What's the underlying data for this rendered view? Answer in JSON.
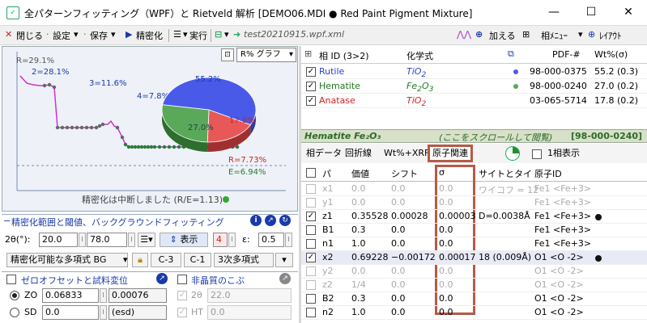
{
  "window": {
    "title": "全パターンフィッティング（WPF）と Rietveld 解析 [DEMO06.MDI ● Red Paint Pigment Mixture]",
    "minimize": "—",
    "maximize": "☐",
    "close": "✕"
  },
  "toolbar": {
    "close": "閉じる",
    "settings": "設定",
    "save": "保存",
    "refine": "精密化",
    "run": "実行",
    "filename": "test20210915.wpf.xml",
    "add": "加える",
    "phase_menu": "相ﾒﾆｭｰ",
    "layout": "ﾚｲｱｳﾄ"
  },
  "chart": {
    "r_label": "R=29.1%",
    "p2": "2=28.1%",
    "p3": "3=11.6%",
    "p4": "4=7.8%",
    "r_final": "R=7.73%",
    "e_final": "E=6.94%",
    "status": "精密化は中断しました (R/E=1.13)",
    "mode": "R% グラフ",
    "pie": [
      {
        "label": "55.2%",
        "value": 55.2,
        "color": "#4a5ae8"
      },
      {
        "label": "17.8%",
        "value": 17.8,
        "color": "#e85858"
      },
      {
        "label": "27.0%",
        "value": 27.0,
        "color": "#5aa85a"
      }
    ]
  },
  "settings": {
    "section1": "精密化範囲と閾値、バックグラウンドフィッティング",
    "two_theta_label": "2θ(°):",
    "two_theta_min": "20.0",
    "two_theta_max": "78.0",
    "show": "表示",
    "num4": "4",
    "eps_label": "ε:",
    "eps": "0.5",
    "bg_model": "精密化可能な多項式 BG",
    "c3": "C-3",
    "c1": "C-1",
    "poly": "3次多項式",
    "section2": "ゼロオフセットと試料変位",
    "section3": "非晶質のこぶ",
    "zo_label": "ZO",
    "zo_value": "0.06833",
    "zo_err": "0.00076",
    "sd_label": "SD",
    "sd_value": "0.0",
    "sd_err": "(esd)",
    "theta2_label": "2θ",
    "theta2_value": "22.0",
    "ht_label": "HT",
    "ht_value": "0.0"
  },
  "phases": {
    "col_id": "相 ID (3>2)",
    "col_formula": "化学式",
    "col_pdf": "PDF-#",
    "col_wt": "Wt%(σ)",
    "rows": [
      {
        "name": "Rutile",
        "formula": "TiO",
        "sub": "2",
        "pdf": "98-000-0375",
        "wt": "55.2 (0.3)",
        "color": "#2244cc",
        "dot": "#4a5ae8"
      },
      {
        "name": "Hematite",
        "formula": "Fe",
        "sub": "2",
        "formula2": "O",
        "sub2": "3",
        "pdf": "98-000-0240",
        "wt": "27.0 (0.2)",
        "color": "#227722",
        "dot": "#5aa85a"
      },
      {
        "name": "Anatase",
        "formula": "TiO",
        "sub": "2",
        "pdf": "03-065-5714",
        "wt": "17.8 (0.2)",
        "color": "#cc2222",
        "dot": ""
      }
    ]
  },
  "detail": {
    "phase_name": "Hematite Fe₂O₃",
    "hint": "(ここをスクロールして閲覧)",
    "pdf": "[98-000-0240]",
    "tabs": [
      "相データ",
      "回折線",
      "Wt%+XRF",
      "原子関連"
    ],
    "single": "1相表示",
    "headers": [
      "パ",
      "価値",
      "シフト",
      "σ",
      "サイトとタイ",
      "原子ID"
    ],
    "rows": [
      {
        "p": "x1",
        "v": "0.0",
        "s": "0.0",
        "sig": "0.0",
        "site": "ワイコフ = 12",
        "atom": "Fe1 <Fe+3>",
        "checked": false,
        "gray": true,
        "dot": false
      },
      {
        "p": "y1",
        "v": "0.0",
        "s": "0.0",
        "sig": "0.0",
        "site": "",
        "atom": "Fe1 <Fe+3>",
        "checked": false,
        "gray": true,
        "dot": false
      },
      {
        "p": "z1",
        "v": "0.35528",
        "s": "0.00028",
        "sig": "0.00003",
        "site": "D=0.0038Å",
        "atom": "Fe1 <Fe+3>",
        "checked": true,
        "gray": false,
        "dot": true
      },
      {
        "p": "B1",
        "v": "0.3",
        "s": "0.0",
        "sig": "0.0",
        "site": "",
        "atom": "Fe1 <Fe+3>",
        "checked": false,
        "gray": false,
        "dot": false
      },
      {
        "p": "n1",
        "v": "1.0",
        "s": "0.0",
        "sig": "0.0",
        "site": "",
        "atom": "Fe1 <Fe+3>",
        "checked": false,
        "gray": false,
        "dot": false
      },
      {
        "p": "x2",
        "v": "0.69228",
        "s": "−0.00172",
        "sig": "0.00017",
        "site": "18 (0.009Å)",
        "atom": "O1 <O -2>",
        "checked": true,
        "gray": false,
        "dot": true,
        "hl": true
      },
      {
        "p": "y2",
        "v": "0.0",
        "s": "0.0",
        "sig": "0.0",
        "site": "",
        "atom": "O1 <O -2>",
        "checked": false,
        "gray": true,
        "dot": false
      },
      {
        "p": "z2",
        "v": "1/4",
        "s": "0.0",
        "sig": "0.0",
        "site": "",
        "atom": "O1 <O -2>",
        "checked": false,
        "gray": true,
        "dot": false
      },
      {
        "p": "B2",
        "v": "0.3",
        "s": "0.0",
        "sig": "0.0",
        "site": "",
        "atom": "O1 <O -2>",
        "checked": false,
        "gray": false,
        "dot": false
      },
      {
        "p": "n2",
        "v": "1.0",
        "s": "0.0",
        "sig": "0.0",
        "site": "",
        "atom": "O1 <O -2>",
        "checked": false,
        "gray": false,
        "dot": false
      }
    ]
  }
}
